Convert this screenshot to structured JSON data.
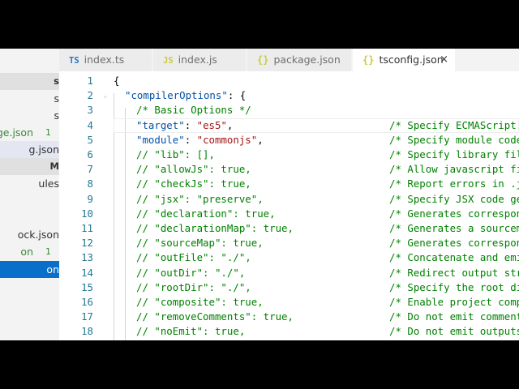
{
  "sidebar": {
    "items": [
      {
        "text": "s",
        "kind": "header"
      },
      {
        "text": "s",
        "kind": "dim"
      },
      {
        "text": "s",
        "kind": "dim"
      },
      {
        "text": "ge.json",
        "badge": "1",
        "kind": "green"
      },
      {
        "text": "g.json",
        "kind": "hl"
      },
      {
        "text": "M",
        "kind": "header"
      },
      {
        "text": "ules",
        "kind": "dim"
      },
      {
        "text": "",
        "kind": "dim"
      },
      {
        "text": "",
        "kind": "dim"
      },
      {
        "text": "ock.json",
        "kind": "dim"
      },
      {
        "text": "on",
        "badge": "1",
        "kind": "green"
      },
      {
        "text": "on",
        "kind": "sel"
      }
    ]
  },
  "tabs": [
    {
      "icon": "TS",
      "label": "index.ts",
      "active": false
    },
    {
      "icon": "JS",
      "label": "index.js",
      "active": false
    },
    {
      "icon": "{}",
      "label": "package.json",
      "active": false
    },
    {
      "icon": "{}",
      "label": "tsconfig.json",
      "active": true,
      "close": "×"
    }
  ],
  "editor": {
    "lines": [
      {
        "n": "1",
        "indent": 0,
        "code": "{",
        "comment": ""
      },
      {
        "n": "2",
        "indent": 1,
        "key": "\"compilerOptions\"",
        "rest": ": {",
        "comment": ""
      },
      {
        "n": "3",
        "indent": 2,
        "code": "/* Basic Options */",
        "type": "comment",
        "comment": ""
      },
      {
        "n": "4",
        "indent": 2,
        "key": "\"target\"",
        "sep": ": ",
        "val": "\"es5\"",
        "rest": ",",
        "comment": "/* Specify ECMAScript"
      },
      {
        "n": "5",
        "indent": 2,
        "key": "\"module\"",
        "sep": ": ",
        "val": "\"commonjs\"",
        "rest": ",",
        "comment": "/* Specify module code"
      },
      {
        "n": "6",
        "indent": 2,
        "code": "// \"lib\": [],",
        "type": "comment",
        "comment": "/* Specify library fil"
      },
      {
        "n": "7",
        "indent": 2,
        "code": "// \"allowJs\": true,",
        "type": "comment",
        "comment": "/* Allow javascript fi"
      },
      {
        "n": "8",
        "indent": 2,
        "code": "// \"checkJs\": true,",
        "type": "comment",
        "comment": "/* Report errors in .j"
      },
      {
        "n": "9",
        "indent": 2,
        "code": "// \"jsx\": \"preserve\",",
        "type": "comment",
        "comment": "/* Specify JSX code ge"
      },
      {
        "n": "10",
        "indent": 2,
        "code": "// \"declaration\": true,",
        "type": "comment",
        "comment": "/* Generates correspon"
      },
      {
        "n": "11",
        "indent": 2,
        "code": "// \"declarationMap\": true,",
        "type": "comment",
        "comment": "/* Generates a sourcem"
      },
      {
        "n": "12",
        "indent": 2,
        "code": "// \"sourceMap\": true,",
        "type": "comment",
        "comment": "/* Generates correspon"
      },
      {
        "n": "13",
        "indent": 2,
        "code": "// \"outFile\": \"./\",",
        "type": "comment",
        "comment": "/* Concatenate and emi"
      },
      {
        "n": "14",
        "indent": 2,
        "code": "// \"outDir\": \"./\",",
        "type": "comment",
        "comment": "/* Redirect output str"
      },
      {
        "n": "15",
        "indent": 2,
        "code": "// \"rootDir\": \"./\",",
        "type": "comment",
        "comment": "/* Specify the root di"
      },
      {
        "n": "16",
        "indent": 2,
        "code": "// \"composite\": true,",
        "type": "comment",
        "comment": "/* Enable project comp"
      },
      {
        "n": "17",
        "indent": 2,
        "code": "// \"removeComments\": true,",
        "type": "comment",
        "comment": "/* Do not emit comment"
      },
      {
        "n": "18",
        "indent": 2,
        "code": "// \"noEmit\": true,",
        "type": "comment",
        "comment": "/* Do not emit outputs"
      }
    ]
  },
  "colors": {
    "sidebar_selected": "#0a6fc8",
    "line_number": "#237893",
    "json_key": "#0451a5",
    "json_string": "#a31515",
    "comment": "#008000"
  }
}
